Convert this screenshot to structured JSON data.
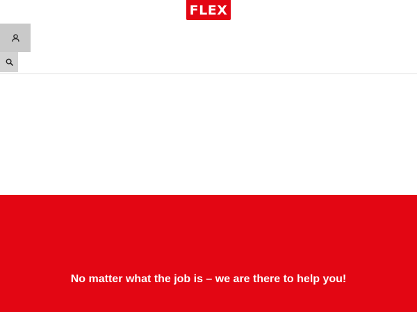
{
  "brand": {
    "logo_text": "FLEX",
    "color": "#e30613"
  },
  "header": {
    "account_icon": "user-icon",
    "search_icon": "search-icon"
  },
  "hero": {
    "headline": "No matter what the job is – we are there to help you!",
    "background_color": "#e30613"
  }
}
